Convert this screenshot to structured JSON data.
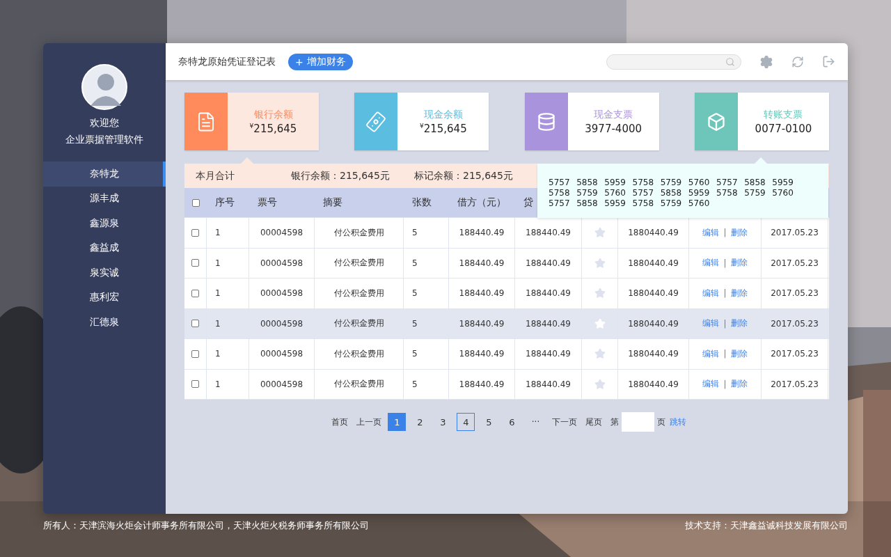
{
  "sidebar": {
    "greeting": "欢迎您",
    "app_name": "企业票据管理软件",
    "items": [
      {
        "label": "奈特龙",
        "selected": true
      },
      {
        "label": "源丰成",
        "selected": false
      },
      {
        "label": "鑫源泉",
        "selected": false
      },
      {
        "label": "鑫益成",
        "selected": false
      },
      {
        "label": "泉实诚",
        "selected": false
      },
      {
        "label": "惠利宏",
        "selected": false
      },
      {
        "label": "汇德泉",
        "selected": false
      }
    ]
  },
  "toolbar": {
    "title": "奈特龙原始凭证登记表",
    "add_button": {
      "icon": "+",
      "label": "增加财务"
    }
  },
  "cards": [
    {
      "kind": "document",
      "title": "银行余额",
      "value": "$^{¥}$215,645",
      "color": "#ff8a5c",
      "selected": true
    },
    {
      "kind": "money",
      "title": "现金余额",
      "value": "$^{¥}$215,645",
      "color": "#5bbde0",
      "selected": false
    },
    {
      "kind": "database",
      "title": "现金支票",
      "value": "3977-4000",
      "color": "#a993dd",
      "selected": false
    },
    {
      "kind": "box",
      "title": "转账支票",
      "value": "0077-0100",
      "color": "#6dc6b9",
      "selected": false
    }
  ],
  "summary": {
    "label": "本月合计",
    "items": [
      "银行余额：215,645元",
      "标记余额：215,645元"
    ]
  },
  "popover": {
    "text": "5757  5858  5959  5758  5759  5760  5757  5858  5959  5758  5759  5760  5757  5858  5959  5758  5759  5760  5757  5858  5959  5758  5759  5760"
  },
  "table": {
    "header_checked": false,
    "columns": [
      "序号",
      "票号",
      "摘要",
      "张数",
      "借方（元）",
      "贷"
    ],
    "rows": [
      {
        "checked": false,
        "selected": false,
        "cells": [
          "1",
          "00004598",
          "付公积金费用",
          "5",
          "188440.49",
          "188440.49",
          "1880440.49"
        ],
        "actions": [
          "编辑",
          "|",
          "删除"
        ],
        "date": "2017.05.23"
      },
      {
        "checked": false,
        "selected": false,
        "cells": [
          "1",
          "00004598",
          "付公积金费用",
          "5",
          "188440.49",
          "188440.49",
          "1880440.49"
        ],
        "actions": [
          "编辑",
          "|",
          "删除"
        ],
        "date": "2017.05.23"
      },
      {
        "checked": false,
        "selected": false,
        "cells": [
          "1",
          "00004598",
          "付公积金费用",
          "5",
          "188440.49",
          "188440.49",
          "1880440.49"
        ],
        "actions": [
          "编辑",
          "|",
          "删除"
        ],
        "date": "2017.05.23"
      },
      {
        "checked": false,
        "selected": true,
        "cells": [
          "1",
          "00004598",
          "付公积金费用",
          "5",
          "188440.49",
          "188440.49",
          "1880440.49"
        ],
        "actions": [
          "编辑",
          "|",
          "删除"
        ],
        "date": "2017.05.23"
      },
      {
        "checked": false,
        "selected": false,
        "cells": [
          "1",
          "00004598",
          "付公积金费用",
          "5",
          "188440.49",
          "188440.49",
          "1880440.49"
        ],
        "actions": [
          "编辑",
          "|",
          "删除"
        ],
        "date": "2017.05.23"
      },
      {
        "checked": false,
        "selected": false,
        "cells": [
          "1",
          "00004598",
          "付公积金费用",
          "5",
          "188440.49",
          "188440.49",
          "1880440.49"
        ],
        "actions": [
          "编辑",
          "|",
          "删除"
        ],
        "date": "2017.05.23"
      }
    ]
  },
  "pagination": {
    "first": "首页",
    "prev": "上一页",
    "pages": [
      {
        "label": "1",
        "selected": true,
        "focused": false
      },
      {
        "label": "2",
        "selected": false,
        "focused": false
      },
      {
        "label": "3",
        "selected": false,
        "focused": false
      },
      {
        "label": "4",
        "selected": false,
        "focused": true
      },
      {
        "label": "5",
        "selected": false,
        "focused": false
      },
      {
        "label": "6",
        "selected": false,
        "focused": false
      }
    ],
    "ellipsis": "···",
    "next": "下一页",
    "last": "尾页",
    "goto_prefix": "第",
    "goto_suffix": "页",
    "goto_button": "跳转"
  },
  "footer": {
    "owner": "所有人：天津滨海火炬会计师事务所有限公司，天津火炬火税务师事务所有限公司",
    "support": "技术支持：天津鑫益诚科技发展有限公司"
  }
}
